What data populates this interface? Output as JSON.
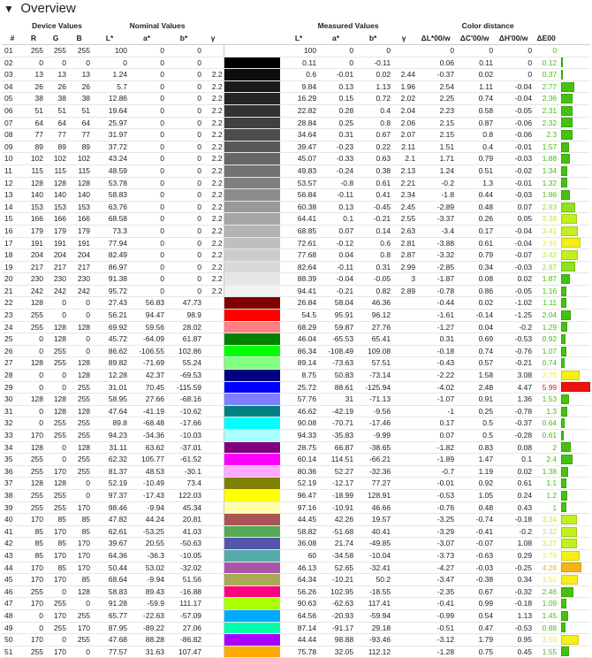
{
  "header": {
    "title": "Overview"
  },
  "groups": {
    "device": "Device Values",
    "nominal": "Nominal Values",
    "measured": "Measured Values",
    "distance": "Color distance"
  },
  "columns": {
    "num": "#",
    "r": "R",
    "g": "G",
    "b": "B",
    "L": "L*",
    "a": "a*",
    "bb": "b*",
    "gamma": "γ",
    "dL": "ΔL*00/w",
    "dC": "ΔC'00/w",
    "dH": "ΔH'00/w",
    "dE": "ΔE00"
  },
  "rows": [
    [
      "01",
      "255",
      "255",
      "255",
      "100",
      "0",
      "0",
      "",
      "#ffffff",
      "100",
      "0",
      "0",
      "",
      "0",
      "0",
      "0",
      "0",
      "#45c20e",
      0.0
    ],
    [
      "02",
      "0",
      "0",
      "0",
      "0",
      "0",
      "0",
      "",
      "#000000",
      "0.11",
      "0",
      "-0.11",
      "",
      "0.06",
      "0.11",
      "0",
      "0.12",
      "#45c20e",
      0.02
    ],
    [
      "03",
      "13",
      "13",
      "13",
      "1.24",
      "0",
      "0",
      "2.2",
      "#0d0d0d",
      "0.6",
      "-0.01",
      "0.02",
      "2.44",
      "-0.37",
      "0.02",
      "0",
      "0.37",
      "#45c20e",
      0.06
    ],
    [
      "04",
      "26",
      "26",
      "26",
      "5.7",
      "0",
      "0",
      "2.2",
      "#1a1a1a",
      "9.84",
      "0.13",
      "1.13",
      "1.96",
      "2.54",
      "1.11",
      "-0.04",
      "2.77",
      "#45c20e",
      0.46
    ],
    [
      "05",
      "38",
      "38",
      "38",
      "12.86",
      "0",
      "0",
      "2.2",
      "#262626",
      "16.29",
      "0.15",
      "0.72",
      "2.02",
      "2.25",
      "0.74",
      "-0.04",
      "2.36",
      "#45c20e",
      0.39
    ],
    [
      "06",
      "51",
      "51",
      "51",
      "19.64",
      "0",
      "0",
      "2.2",
      "#333333",
      "22.82",
      "0.28",
      "0.4",
      "2.04",
      "2.23",
      "0.58",
      "-0.05",
      "2.31",
      "#45c20e",
      0.39
    ],
    [
      "07",
      "64",
      "64",
      "64",
      "25.97",
      "0",
      "0",
      "2.2",
      "#404040",
      "28.84",
      "0.25",
      "0.8",
      "2.06",
      "2.15",
      "0.87",
      "-0.06",
      "2.32",
      "#45c20e",
      0.39
    ],
    [
      "08",
      "77",
      "77",
      "77",
      "31.97",
      "0",
      "0",
      "2.2",
      "#4d4d4d",
      "34.64",
      "0.31",
      "0.67",
      "2.07",
      "2.15",
      "0.8",
      "-0.06",
      "2.3",
      "#45c20e",
      0.38
    ],
    [
      "09",
      "89",
      "89",
      "89",
      "37.72",
      "0",
      "0",
      "2.2",
      "#595959",
      "39.47",
      "-0.23",
      "0.22",
      "2.11",
      "1.51",
      "0.4",
      "-0.01",
      "1.57",
      "#45c20e",
      0.26
    ],
    [
      "10",
      "102",
      "102",
      "102",
      "43.24",
      "0",
      "0",
      "2.2",
      "#666666",
      "45.07",
      "-0.33",
      "0.63",
      "2.1",
      "1.71",
      "0.79",
      "-0.03",
      "1.88",
      "#45c20e",
      0.31
    ],
    [
      "11",
      "115",
      "115",
      "115",
      "48.59",
      "0",
      "0",
      "2.2",
      "#737373",
      "49.83",
      "-0.24",
      "0.38",
      "2.13",
      "1.24",
      "0.51",
      "-0.02",
      "1.34",
      "#45c20e",
      0.22
    ],
    [
      "12",
      "128",
      "128",
      "128",
      "53.78",
      "0",
      "0",
      "2.2",
      "#808080",
      "53.57",
      "-0.8",
      "0.61",
      "2.21",
      "-0.2",
      "1.3",
      "-0.01",
      "1.32",
      "#45c20e",
      0.22
    ],
    [
      "13",
      "140",
      "140",
      "140",
      "58.83",
      "0",
      "0",
      "2.2",
      "#8c8c8c",
      "56.84",
      "-0.11",
      "0.41",
      "2.34",
      "-1.8",
      "0.44",
      "-0.03",
      "1.86",
      "#45c20e",
      0.31
    ],
    [
      "14",
      "153",
      "153",
      "153",
      "63.76",
      "0",
      "0",
      "2.2",
      "#999999",
      "60.38",
      "0.13",
      "-0.45",
      "2.45",
      "-2.89",
      "0.48",
      "0.07",
      "2.93",
      "#8fe21e",
      0.49
    ],
    [
      "15",
      "166",
      "166",
      "166",
      "68.58",
      "0",
      "0",
      "2.2",
      "#a6a6a6",
      "64.41",
      "0.1",
      "-0.21",
      "2.55",
      "-3.37",
      "0.26",
      "0.05",
      "3.38",
      "#c2ef1e",
      0.56
    ],
    [
      "16",
      "179",
      "179",
      "179",
      "73.3",
      "0",
      "0",
      "2.2",
      "#b3b3b3",
      "68.85",
      "0.07",
      "0.14",
      "2.63",
      "-3.4",
      "0.17",
      "-0.04",
      "3.41",
      "#c2ef1e",
      0.57
    ],
    [
      "17",
      "191",
      "191",
      "191",
      "77.94",
      "0",
      "0",
      "2.2",
      "#bfbfbf",
      "72.61",
      "-0.12",
      "0.6",
      "2.81",
      "-3.88",
      "0.61",
      "-0.04",
      "3.93",
      "#f6ef14",
      0.66
    ],
    [
      "18",
      "204",
      "204",
      "204",
      "82.49",
      "0",
      "0",
      "2.2",
      "#cccccc",
      "77.68",
      "0.04",
      "0.8",
      "2.87",
      "-3.32",
      "0.79",
      "-0.07",
      "3.42",
      "#c2ef1e",
      0.57
    ],
    [
      "19",
      "217",
      "217",
      "217",
      "86.97",
      "0",
      "0",
      "2.2",
      "#d9d9d9",
      "82.64",
      "-0.11",
      "0.31",
      "2.99",
      "-2.85",
      "0.34",
      "-0.03",
      "2.87",
      "#8fe21e",
      0.48
    ],
    [
      "20",
      "230",
      "230",
      "230",
      "91.38",
      "0",
      "0",
      "2.2",
      "#e6e6e6",
      "88.39",
      "-0.04",
      "-0.05",
      "3",
      "-1.87",
      "0.08",
      "0.02",
      "1.87",
      "#45c20e",
      0.31
    ],
    [
      "21",
      "242",
      "242",
      "242",
      "95.72",
      "0",
      "0",
      "2.2",
      "#f2f2f2",
      "94.41",
      "-0.21",
      "0.82",
      "2.89",
      "-0.78",
      "0.86",
      "-0.05",
      "1.16",
      "#45c20e",
      0.19
    ],
    [
      "22",
      "128",
      "0",
      "0",
      "27.43",
      "56.83",
      "47.73",
      "",
      "#800000",
      "26.84",
      "58.04",
      "46.36",
      "",
      "-0.44",
      "0.02",
      "-1.02",
      "1.11",
      "#45c20e",
      0.19
    ],
    [
      "23",
      "255",
      "0",
      "0",
      "56.21",
      "94.47",
      "98.9",
      "",
      "#ff0000",
      "54.5",
      "95.91",
      "96.12",
      "",
      "-1.61",
      "-0.14",
      "-1.25",
      "2.04",
      "#45c20e",
      0.34
    ],
    [
      "24",
      "255",
      "128",
      "128",
      "69.92",
      "59.56",
      "28.02",
      "",
      "#ff8080",
      "68.29",
      "59.87",
      "27.76",
      "",
      "-1.27",
      "0.04",
      "-0.2",
      "1.29",
      "#45c20e",
      0.22
    ],
    [
      "25",
      "0",
      "128",
      "0",
      "45.72",
      "-64.09",
      "61.87",
      "",
      "#008000",
      "46.04",
      "-65.53",
      "65.41",
      "",
      "0.31",
      "0.69",
      "-0.53",
      "0.92",
      "#45c20e",
      0.15
    ],
    [
      "26",
      "0",
      "255",
      "0",
      "86.62",
      "-106.55",
      "102.86",
      "",
      "#00ff00",
      "86.34",
      "-108.49",
      "109.08",
      "",
      "-0.18",
      "0.74",
      "-0.76",
      "1.07",
      "#45c20e",
      0.18
    ],
    [
      "27",
      "128",
      "255",
      "128",
      "89.82",
      "-71.69",
      "55.24",
      "",
      "#80ff80",
      "89.14",
      "-73.63",
      "57.51",
      "",
      "-0.43",
      "0.57",
      "-0.21",
      "0.74",
      "#45c20e",
      0.12
    ],
    [
      "28",
      "0",
      "0",
      "128",
      "12.28",
      "42.37",
      "-69.53",
      "",
      "#000080",
      "8.75",
      "50.83",
      "-73.14",
      "",
      "-2.22",
      "1.58",
      "3.08",
      "3.75",
      "#f6ef14",
      0.63
    ],
    [
      "29",
      "0",
      "0",
      "255",
      "31.01",
      "70.45",
      "-115.59",
      "",
      "#0000ff",
      "25.72",
      "88.61",
      "-125.94",
      "",
      "-4.02",
      "2.48",
      "4.47",
      "5.99",
      "#ee1111",
      1.0
    ],
    [
      "30",
      "128",
      "128",
      "255",
      "58.95",
      "27.66",
      "-68.16",
      "",
      "#8080ff",
      "57.76",
      "31",
      "-71.13",
      "",
      "-1.07",
      "0.91",
      "1.36",
      "1.53",
      "#45c20e",
      0.26
    ],
    [
      "31",
      "0",
      "128",
      "128",
      "47.64",
      "-41.19",
      "-10.62",
      "",
      "#008080",
      "46.62",
      "-42.19",
      "-9.56",
      "",
      "-1",
      "0.25",
      "-0.78",
      "1.3",
      "#45c20e",
      0.22
    ],
    [
      "32",
      "0",
      "255",
      "255",
      "89.8",
      "-68.48",
      "-17.66",
      "",
      "#00ffff",
      "90.08",
      "-70.71",
      "-17.46",
      "",
      "0.17",
      "0.5",
      "-0.37",
      "0.64",
      "#45c20e",
      0.11
    ],
    [
      "33",
      "170",
      "255",
      "255",
      "94.23",
      "-34.36",
      "-10.03",
      "",
      "#aaffff",
      "94.33",
      "-35.83",
      "-9.99",
      "",
      "0.07",
      "0.5",
      "-0.28",
      "0.61",
      "#45c20e",
      0.1
    ],
    [
      "34",
      "128",
      "0",
      "128",
      "31.11",
      "63.62",
      "-37.01",
      "",
      "#800080",
      "28.75",
      "66.87",
      "-38.65",
      "",
      "-1.82",
      "0.83",
      "0.08",
      "2",
      "#45c20e",
      0.33
    ],
    [
      "35",
      "255",
      "0",
      "255",
      "62.32",
      "105.77",
      "-61.52",
      "",
      "#ff00ff",
      "60.14",
      "114.51",
      "-66.21",
      "",
      "-1.89",
      "1.47",
      "0.1",
      "2.4",
      "#45c20e",
      0.4
    ],
    [
      "36",
      "255",
      "170",
      "255",
      "81.37",
      "48.53",
      "-30.1",
      "",
      "#ffaaff",
      "80.36",
      "52.27",
      "-32.36",
      "",
      "-0.7",
      "1.19",
      "0.02",
      "1.38",
      "#45c20e",
      0.23
    ],
    [
      "37",
      "128",
      "128",
      "0",
      "52.19",
      "-10.49",
      "73.4",
      "",
      "#808000",
      "52.19",
      "-12.17",
      "77.27",
      "",
      "-0.01",
      "0.92",
      "0.61",
      "1.1",
      "#45c20e",
      0.18
    ],
    [
      "38",
      "255",
      "255",
      "0",
      "97.37",
      "-17.43",
      "122.03",
      "",
      "#ffff00",
      "96.47",
      "-18.99",
      "128.91",
      "",
      "-0.53",
      "1.05",
      "0.24",
      "1.2",
      "#45c20e",
      0.2
    ],
    [
      "39",
      "255",
      "255",
      "170",
      "98.46",
      "-9.94",
      "45.34",
      "",
      "#ffffaa",
      "97.16",
      "-10.91",
      "46.66",
      "",
      "-0.76",
      "0.48",
      "0.43",
      "1",
      "#45c20e",
      0.17
    ],
    [
      "40",
      "170",
      "85",
      "85",
      "47.82",
      "44.24",
      "20.81",
      "",
      "#aa5555",
      "44.45",
      "42.26",
      "19.57",
      "",
      "-3.25",
      "-0.74",
      "-0.18",
      "3.34",
      "#c2ef1e",
      0.56
    ],
    [
      "41",
      "85",
      "170",
      "85",
      "62.61",
      "-53.25",
      "41.03",
      "",
      "#55aa55",
      "58.82",
      "-51.68",
      "40.41",
      "",
      "-3.29",
      "-0.41",
      "-0.2",
      "3.32",
      "#c2ef1e",
      0.55
    ],
    [
      "42",
      "85",
      "85",
      "170",
      "39.67",
      "20.55",
      "-50.63",
      "",
      "#5555aa",
      "36.08",
      "21.74",
      "-49.85",
      "",
      "-3.07",
      "-0.07",
      "1.08",
      "3.27",
      "#c2ef1e",
      0.55
    ],
    [
      "43",
      "85",
      "170",
      "170",
      "64.36",
      "-36.3",
      "-10.05",
      "",
      "#55aaaa",
      "60",
      "-34.58",
      "-10.04",
      "",
      "-3.73",
      "-0.63",
      "0.29",
      "3.79",
      "#f6ef14",
      0.63
    ],
    [
      "44",
      "170",
      "85",
      "170",
      "50.44",
      "53.02",
      "-32.02",
      "",
      "#aa55aa",
      "46.13",
      "52.65",
      "-32.41",
      "",
      "-4.27",
      "-0.03",
      "-0.25",
      "4.28",
      "#f6b414",
      0.71
    ],
    [
      "45",
      "170",
      "170",
      "85",
      "68.64",
      "-9.94",
      "51.56",
      "",
      "#aaaa55",
      "64.34",
      "-10.21",
      "50.2",
      "",
      "-3.47",
      "-0.38",
      "0.34",
      "3.51",
      "#f6ef14",
      0.59
    ],
    [
      "46",
      "255",
      "0",
      "128",
      "58.83",
      "89.43",
      "-16.88",
      "",
      "#ff0080",
      "56.26",
      "102.95",
      "-18.55",
      "",
      "-2.35",
      "0.67",
      "-0.32",
      "2.46",
      "#45c20e",
      0.41
    ],
    [
      "47",
      "170",
      "255",
      "0",
      "91.28",
      "-59.9",
      "111.17",
      "",
      "#aaff00",
      "90.63",
      "-62.63",
      "117.41",
      "",
      "-0.41",
      "0.99",
      "-0.18",
      "1.09",
      "#45c20e",
      0.18
    ],
    [
      "48",
      "0",
      "170",
      "255",
      "65.77",
      "-22.63",
      "-57.09",
      "",
      "#00aaff",
      "64.56",
      "-20.93",
      "-59.94",
      "",
      "-0.99",
      "0.54",
      "1.13",
      "1.45",
      "#45c20e",
      0.24
    ],
    [
      "49",
      "0",
      "255",
      "170",
      "87.95",
      "-89.22",
      "27.06",
      "",
      "#00ffaa",
      "87.14",
      "-91.17",
      "29.18",
      "",
      "-0.51",
      "0.47",
      "-0.53",
      "0.88",
      "#45c20e",
      0.15
    ],
    [
      "50",
      "170",
      "0",
      "255",
      "47.68",
      "88.28",
      "-86.82",
      "",
      "#aa00ff",
      "44.44",
      "98.88",
      "-93.46",
      "",
      "-3.12",
      "1.79",
      "0.95",
      "3.69",
      "#f6ef14",
      0.62
    ],
    [
      "51",
      "255",
      "170",
      "0",
      "77.57",
      "31.63",
      "107.47",
      "",
      "#ffaa00",
      "75.78",
      "32.05",
      "112.12",
      "",
      "-1.28",
      "0.75",
      "0.45",
      "1.55",
      "#45c20e",
      0.26
    ]
  ]
}
